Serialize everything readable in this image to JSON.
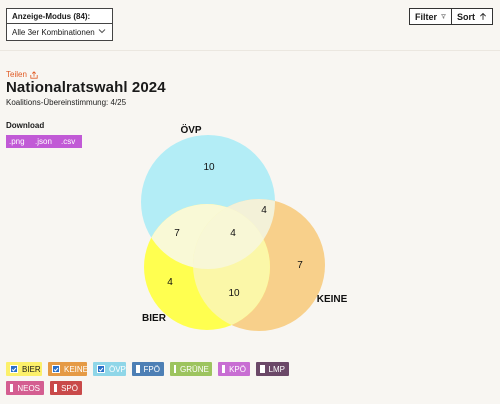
{
  "mode_select": {
    "label": "Anzeige-Modus (84):",
    "value": "Alle 3er Kombinationen"
  },
  "toolbar": {
    "filter_label": "Filter",
    "sort_label": "Sort"
  },
  "share_label": "Teilen",
  "title": "Nationalratswahl 2024",
  "subtitle": "Koalitions-Übereinstimmung: 4/25",
  "download": {
    "label": "Download",
    "formats": [
      ".png",
      ".json",
      ".csv"
    ]
  },
  "venn": {
    "sets": [
      {
        "name": "ÖVP",
        "color": "#b3edf6"
      },
      {
        "name": "KEINE",
        "color": "#f8d08b"
      },
      {
        "name": "BIER",
        "color": "#ffff50"
      }
    ],
    "regions": {
      "oevp_only": "10",
      "oevp_keine": "4",
      "oevp_bier": "7",
      "all_three": "4",
      "keine_only": "7",
      "bier_only": "4",
      "bier_keine": "10"
    }
  },
  "parties": [
    {
      "name": "BIER",
      "checked": true,
      "bg": "#fcf06a",
      "fg": "#1a1a1a",
      "box": "#2a6fc9"
    },
    {
      "name": "KEINE",
      "checked": true,
      "bg": "#e59a45",
      "fg": "#ffffff",
      "box": "#2a6fc9"
    },
    {
      "name": "ÖVP",
      "checked": true,
      "bg": "#8fd6e8",
      "fg": "#ffffff",
      "box": "#2a6fc9"
    },
    {
      "name": "FPÖ",
      "checked": false,
      "bg": "#4d7fb5",
      "fg": "#ffffff"
    },
    {
      "name": "GRÜNE",
      "checked": false,
      "bg": "#9dc45f",
      "fg": "#ffffff"
    },
    {
      "name": "KPÖ",
      "checked": false,
      "bg": "#c86ed3",
      "fg": "#ffffff"
    },
    {
      "name": "LMP",
      "checked": false,
      "bg": "#6b4868",
      "fg": "#ffffff"
    },
    {
      "name": "NEOS",
      "checked": false,
      "bg": "#d45e91",
      "fg": "#ffffff"
    },
    {
      "name": "SPÖ",
      "checked": false,
      "bg": "#c94a4a",
      "fg": "#ffffff"
    }
  ]
}
